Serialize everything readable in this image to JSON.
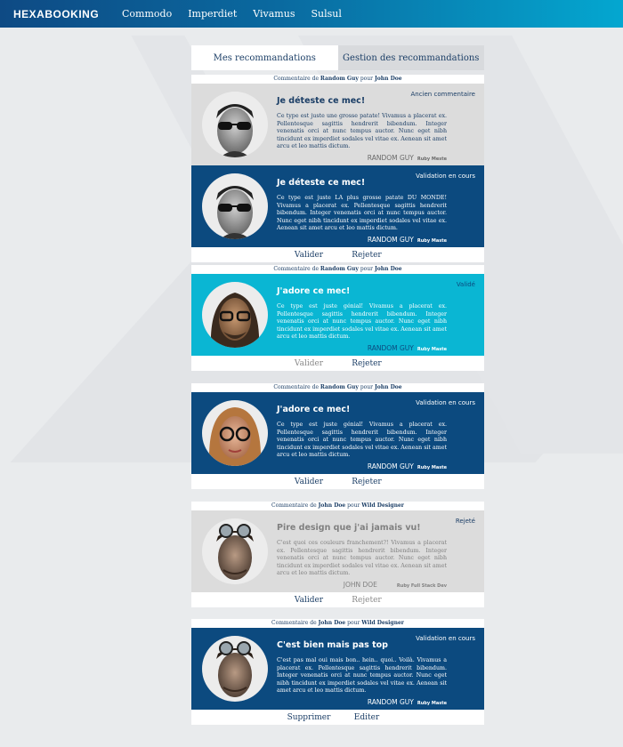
{
  "brand": "HEXABOOKING",
  "nav": [
    "Commodo",
    "Imperdiet",
    "Vivamus",
    "Sulsul"
  ],
  "tabs": [
    "Mes recommandations",
    "Gestion des recommandations"
  ],
  "header_words": {
    "comment_by": "Commentaire de",
    "for": "pour"
  },
  "groups": [
    {
      "author": "Random Guy",
      "target": "John Doe",
      "comments": [
        {
          "title": "Je déteste ce mec!",
          "status": "Ancien commentaire",
          "body": "Ce type est juste une grosse patate! Vivamus a placerat ex. Pellentesque sagittis hendrerit bibendum. Integer venenatis orci at nunc tempus auctor. Nunc eget nibh tincidunt ex imperdiet sodales vel vitae ex. Aenean sit amet arcu et leo mattis dictum.",
          "signer": "RANDOM GUY",
          "role": "Ruby Meste"
        },
        {
          "title": "Je déteste ce mec!",
          "status": "Validation en cours",
          "body": "Ce type est juste LA plus grosse patate DU MONDE! Vivamus a placerat ex. Pellentesque sagittis hendrerit bibendum. Integer venenatis orci at nunc tempus auctor. Nunc eget nibh tincidunt ex imperdiet sodales vel vitae ex. Aenean sit amet arcu et leo mattis dictum.",
          "signer": "RANDOM GUY",
          "role": "Ruby Maste"
        }
      ],
      "actions": [
        "Valider",
        "Rejeter"
      ]
    },
    {
      "author": "Random Guy",
      "target": "John Doe",
      "comments": [
        {
          "title": "J'adore ce mec!",
          "status": "Validé",
          "body": "Ce type est juste génial! Vivamus a placerat ex. Pellentesque sagittis hendrerit bibendum. Integer venenatis orci at nunc tempus auctor. Nunc eget nibh tincidunt ex imperdiet sodales vel vitae ex. Aenean sit amet arcu et leo mattis dictum.",
          "signer": "RANDOM GUY",
          "role": "Ruby Maste"
        }
      ],
      "actions": [
        "Valider",
        "Rejeter"
      ]
    },
    {
      "author": "Random Guy",
      "target": "John Doe",
      "comments": [
        {
          "title": "J'adore ce mec!",
          "status": "Validation en cours",
          "body": "Ce type est juste génial! Vivamus a placerat ex. Pellentesque sagittis hendrerit bibendum. Integer venenatis orci at nunc tempus auctor. Nunc eget nibh tincidunt ex imperdiet sodales vel vitae ex. Aenean sit amet arcu et leo mattis dictum.",
          "signer": "RANDOM GUY",
          "role": "Ruby Maste"
        }
      ],
      "actions": [
        "Valider",
        "Rejeter"
      ]
    },
    {
      "author": "John Doe",
      "target": "Wild Designer",
      "comments": [
        {
          "title": "Pire design que j'ai jamais vu!",
          "status": "Rejeté",
          "body": "C'est quoi ces couleurs franchement?! Vivamus a placerat ex. Pellentesque sagittis hendrerit bibendum. Integer venenatis orci at nunc tempus auctor. Nunc eget nibh tincidunt ex imperdiet sodales vel vitae ex. Aenean sit amet arcu et leo mattis dictum.",
          "signer": "JOHN DOE",
          "role": "Ruby Full Stack Dev"
        }
      ],
      "actions": [
        "Valider",
        "Rejeter"
      ]
    },
    {
      "author": "John Doe",
      "target": "Wild Designer",
      "comments": [
        {
          "title": "C'est bien mais pas top",
          "status": "Validation en cours",
          "body": "C'est pas mal oui mais bon.. hein.. quoi.. Voilà. Vivamus a placerat ex. Pellentesque sagittis hendrerit bibendum. Integer venenatis orci at nunc tempus auctor. Nunc eget nibh tincidunt ex imperdiet sodales vel vitae ex. Aenean sit amet arcu et leo mattis dictum.",
          "signer": "RANDOM GUY",
          "role": "Ruby Maste"
        }
      ],
      "actions": [
        "Supprimer",
        "Editer"
      ]
    }
  ],
  "colors": {
    "navy": "#0c4a7f",
    "cyan": "#0ab6d3",
    "grey": "#dcdcdc",
    "header_start": "#0e4a84",
    "header_end": "#04a7d0"
  },
  "avatars": [
    "sunglasses-man-avatar",
    "sunglasses-man-avatar",
    "long-hair-man-avatar",
    "glasses-woman-avatar",
    "goggles-man-avatar",
    "goggles-man-avatar"
  ]
}
